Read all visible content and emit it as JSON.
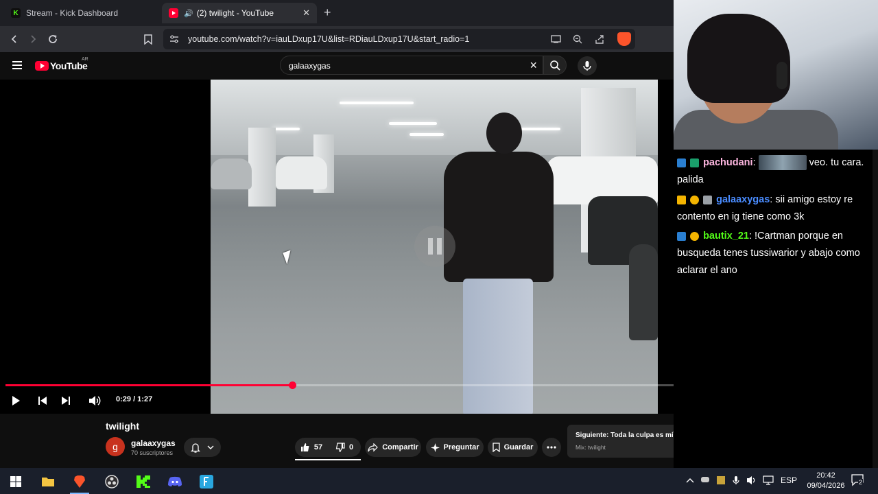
{
  "browser": {
    "tabs": [
      {
        "title": "Stream - Kick Dashboard",
        "active": false
      },
      {
        "title": "(2) twilight - YouTube",
        "active": true
      }
    ],
    "url": "youtube.com/watch?v=iauLDxup17U&list=RDiauLDxup17U&start_radio=1"
  },
  "youtube": {
    "logo_text": "YouTube",
    "region": "AR",
    "search_query": "galaaxygas",
    "player": {
      "time_label": "0:29 / 1:27",
      "progress_fraction": 0.39,
      "buffered_fraction": 1.0
    },
    "video_title": "twilight",
    "channel_initial": "g",
    "channel_name": "galaaxygas",
    "subscribers": "70 suscriptores",
    "likes": "57",
    "dislikes": "0",
    "share_label": "Compartir",
    "ask_label": "Preguntar",
    "save_label": "Guardar",
    "next_label": "Siguiente: Toda la culpa es mía (feat. Bles)",
    "mix_label": "Mix: twilight"
  },
  "chat": {
    "messages": [
      {
        "user": "pachudani",
        "user_color": "#ffb7e1",
        "text_before": ": ",
        "text": "veo. tu cara. palida"
      },
      {
        "user": "galaaxygas",
        "user_color": "#4a8cff",
        "text_before": ": ",
        "text": "sii amigo estoy re contento en ig tiene como 3k"
      },
      {
        "user": "bautix_21",
        "user_color": "#53fc18",
        "text_before": ": ",
        "text": "!Cartman porque en busqueda tenes tussiwarior y abajo como aclarar el ano"
      }
    ]
  },
  "taskbar": {
    "language": "ESP",
    "time": "20:42",
    "date": "09/04/2026",
    "notifications": "2"
  }
}
